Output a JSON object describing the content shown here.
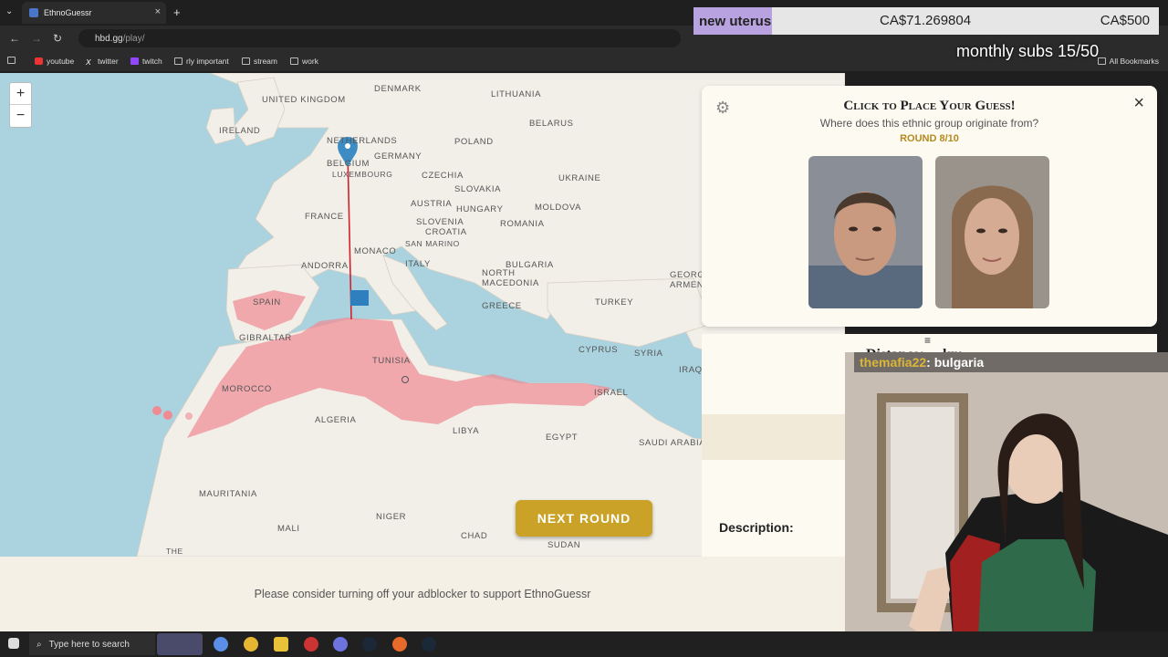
{
  "browser": {
    "tab_title": "EthnoGuessr",
    "url_host": "hbd.gg",
    "url_path": "/play/",
    "bookmarks": [
      "youtube",
      "twitter",
      "twitch",
      "rly important",
      "stream",
      "work"
    ],
    "all_bookmarks": "All Bookmarks"
  },
  "map": {
    "zoom_in": "+",
    "zoom_out": "−",
    "labels": [
      "UNITED KINGDOM",
      "IRELAND",
      "DENMARK",
      "LITHUANIA",
      "NETHERLANDS",
      "BELGIUM",
      "LUXEMBOURG",
      "GERMANY",
      "POLAND",
      "BELARUS",
      "CZECHIA",
      "UKRAINE",
      "SLOVAKIA",
      "AUSTRIA",
      "HUNGARY",
      "MOLDOVA",
      "FRANCE",
      "SLOVENIA",
      "CROATIA",
      "ROMANIA",
      "SAN MARINO",
      "MONACO",
      "ANDORRA",
      "ITALY",
      "BULGARIA",
      "NORTH MACEDONIA",
      "GEORGIA ARMENIA",
      "SPAIN",
      "GREECE",
      "TURKEY",
      "GIBRALTAR",
      "TUNISIA",
      "CYPRUS",
      "SYRIA",
      "IRAQ",
      "MOROCCO",
      "ISRAEL",
      "ALGERIA",
      "LIBYA",
      "EGYPT",
      "SAUDI ARABIA",
      "MAURITANIA",
      "MALI",
      "NIGER",
      "CHAD",
      "SUDAN",
      "THE"
    ],
    "next_round": "NEXT ROUND"
  },
  "guess_panel": {
    "title": "Click to Place Your Guess!",
    "subtitle": "Where does this ethnic group originate from?",
    "round": "ROUND 8/10",
    "close": "×"
  },
  "result_panel": {
    "menu": "≡",
    "distance": "Distance: ... km",
    "description_label": "Description:"
  },
  "footer": {
    "adblock_notice": "Please consider turning off your adblocker to support EthnoGuessr"
  },
  "taskbar": {
    "search_placeholder": "Type here to search"
  },
  "stream_overlay": {
    "goal_name": "new uterus",
    "goal_current": "CA$71.269804",
    "goal_target": "CA$500",
    "subs": "monthly subs 15/50",
    "chat_user": "themafia22",
    "chat_message": ": bulgaria"
  },
  "colors": {
    "sea": "#aad3df",
    "land": "#f2efe9",
    "highlight": "#f08a93",
    "accent_gold": "#c9a227"
  }
}
